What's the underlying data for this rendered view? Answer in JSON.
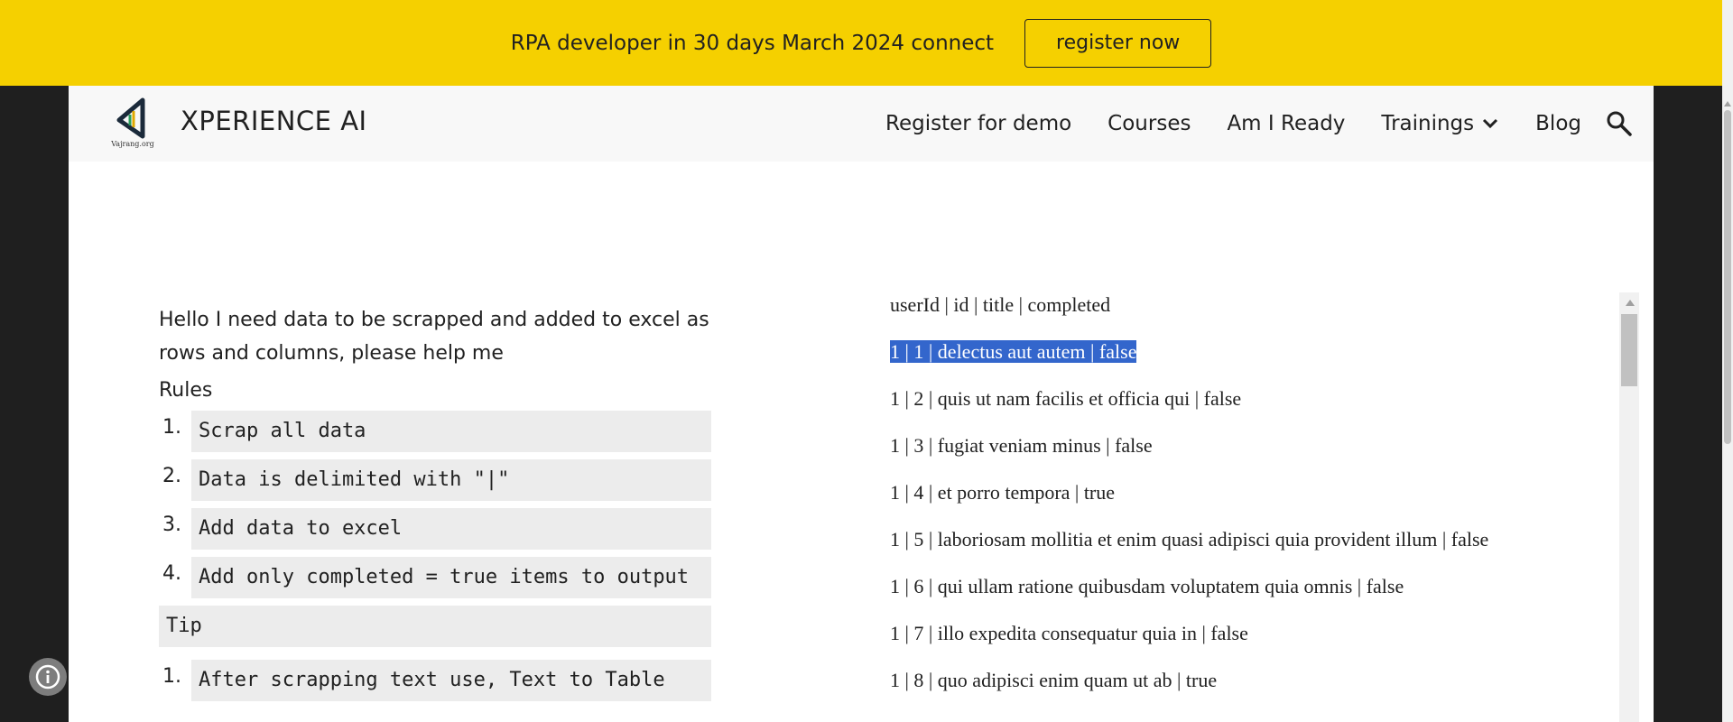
{
  "banner": {
    "text": "RPA developer in 30 days March 2024 connect",
    "button_label": "register now"
  },
  "header": {
    "logo_subtext": "Vajrang.org",
    "site_title": "XPERIENCE AI",
    "nav": {
      "register_demo": "Register for demo",
      "courses": "Courses",
      "am_i_ready": "Am I Ready",
      "trainings": "Trainings",
      "blog": "Blog"
    }
  },
  "content": {
    "intro": "Hello I need data to be scrapped and added to excel as rows and columns, please help me",
    "rules_heading": "Rules",
    "rules": [
      {
        "num": "1.",
        "text": "Scrap all data"
      },
      {
        "num": "2.",
        "text": "Data is delimited with \"|\""
      },
      {
        "num": "3.",
        "text": "Add data to excel"
      },
      {
        "num": "4.",
        "text": "Add only completed = true items to output"
      }
    ],
    "tip_label": "Tip",
    "tips": [
      {
        "num": "1.",
        "text": "After scrapping text use, Text to Table"
      }
    ]
  },
  "data_frame": {
    "lines": [
      "userId | id | title | completed",
      "1 | 1 | delectus aut autem | false",
      "1 | 2 | quis ut nam facilis et officia qui | false",
      "1 | 3 | fugiat veniam minus | false",
      "1 | 4 | et porro tempora | true",
      "1 | 5 | laboriosam mollitia et enim quasi adipisci quia provident illum | false",
      "1 | 6 | qui ullam ratione quibusdam voluptatem quia omnis | false",
      "1 | 7 | illo expedita consequatur quia in | false",
      "1 | 8 | quo adipisci enim quam ut ab | true"
    ]
  },
  "colors": {
    "banner": "#f5d000",
    "selection": "#3366cc"
  },
  "icons": [
    "chevron-down-icon",
    "search-icon",
    "info-icon",
    "logo-icon"
  ]
}
